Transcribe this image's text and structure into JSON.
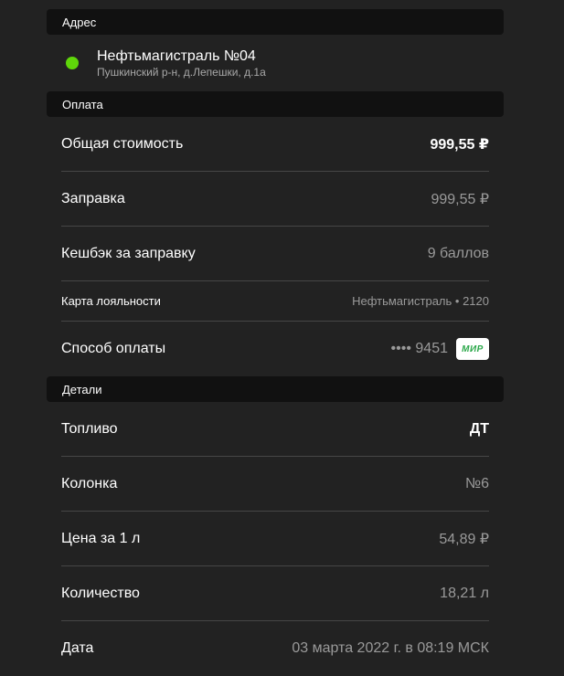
{
  "address_section": {
    "header": "Адрес",
    "station_name": "Нефтьмагистраль №04",
    "station_address": "Пушкинский р-н, д.Лепешки, д.1а",
    "status_color": "#5fd70a"
  },
  "payment_section": {
    "header": "Оплата",
    "total_label": "Общая стоимость",
    "total_value": "999,55 ₽",
    "refuel_label": "Заправка",
    "refuel_value": "999,55 ₽",
    "cashback_label": "Кешбэк за заправку",
    "cashback_value": "9 баллов",
    "loyalty_label": "Карта лояльности",
    "loyalty_value": "Нефтьмагистраль • 2120",
    "method_label": "Способ оплаты",
    "method_card": "•••• 9451",
    "method_brand": "МИР"
  },
  "details_section": {
    "header": "Детали",
    "fuel_label": "Топливо",
    "fuel_value": "ДТ",
    "pump_label": "Колонка",
    "pump_value": "№6",
    "price_label": "Цена за 1 л",
    "price_value": "54,89 ₽",
    "quantity_label": "Количество",
    "quantity_value": "18,21 л",
    "date_label": "Дата",
    "date_value": "03 марта 2022 г. в 08:19 МСК"
  }
}
